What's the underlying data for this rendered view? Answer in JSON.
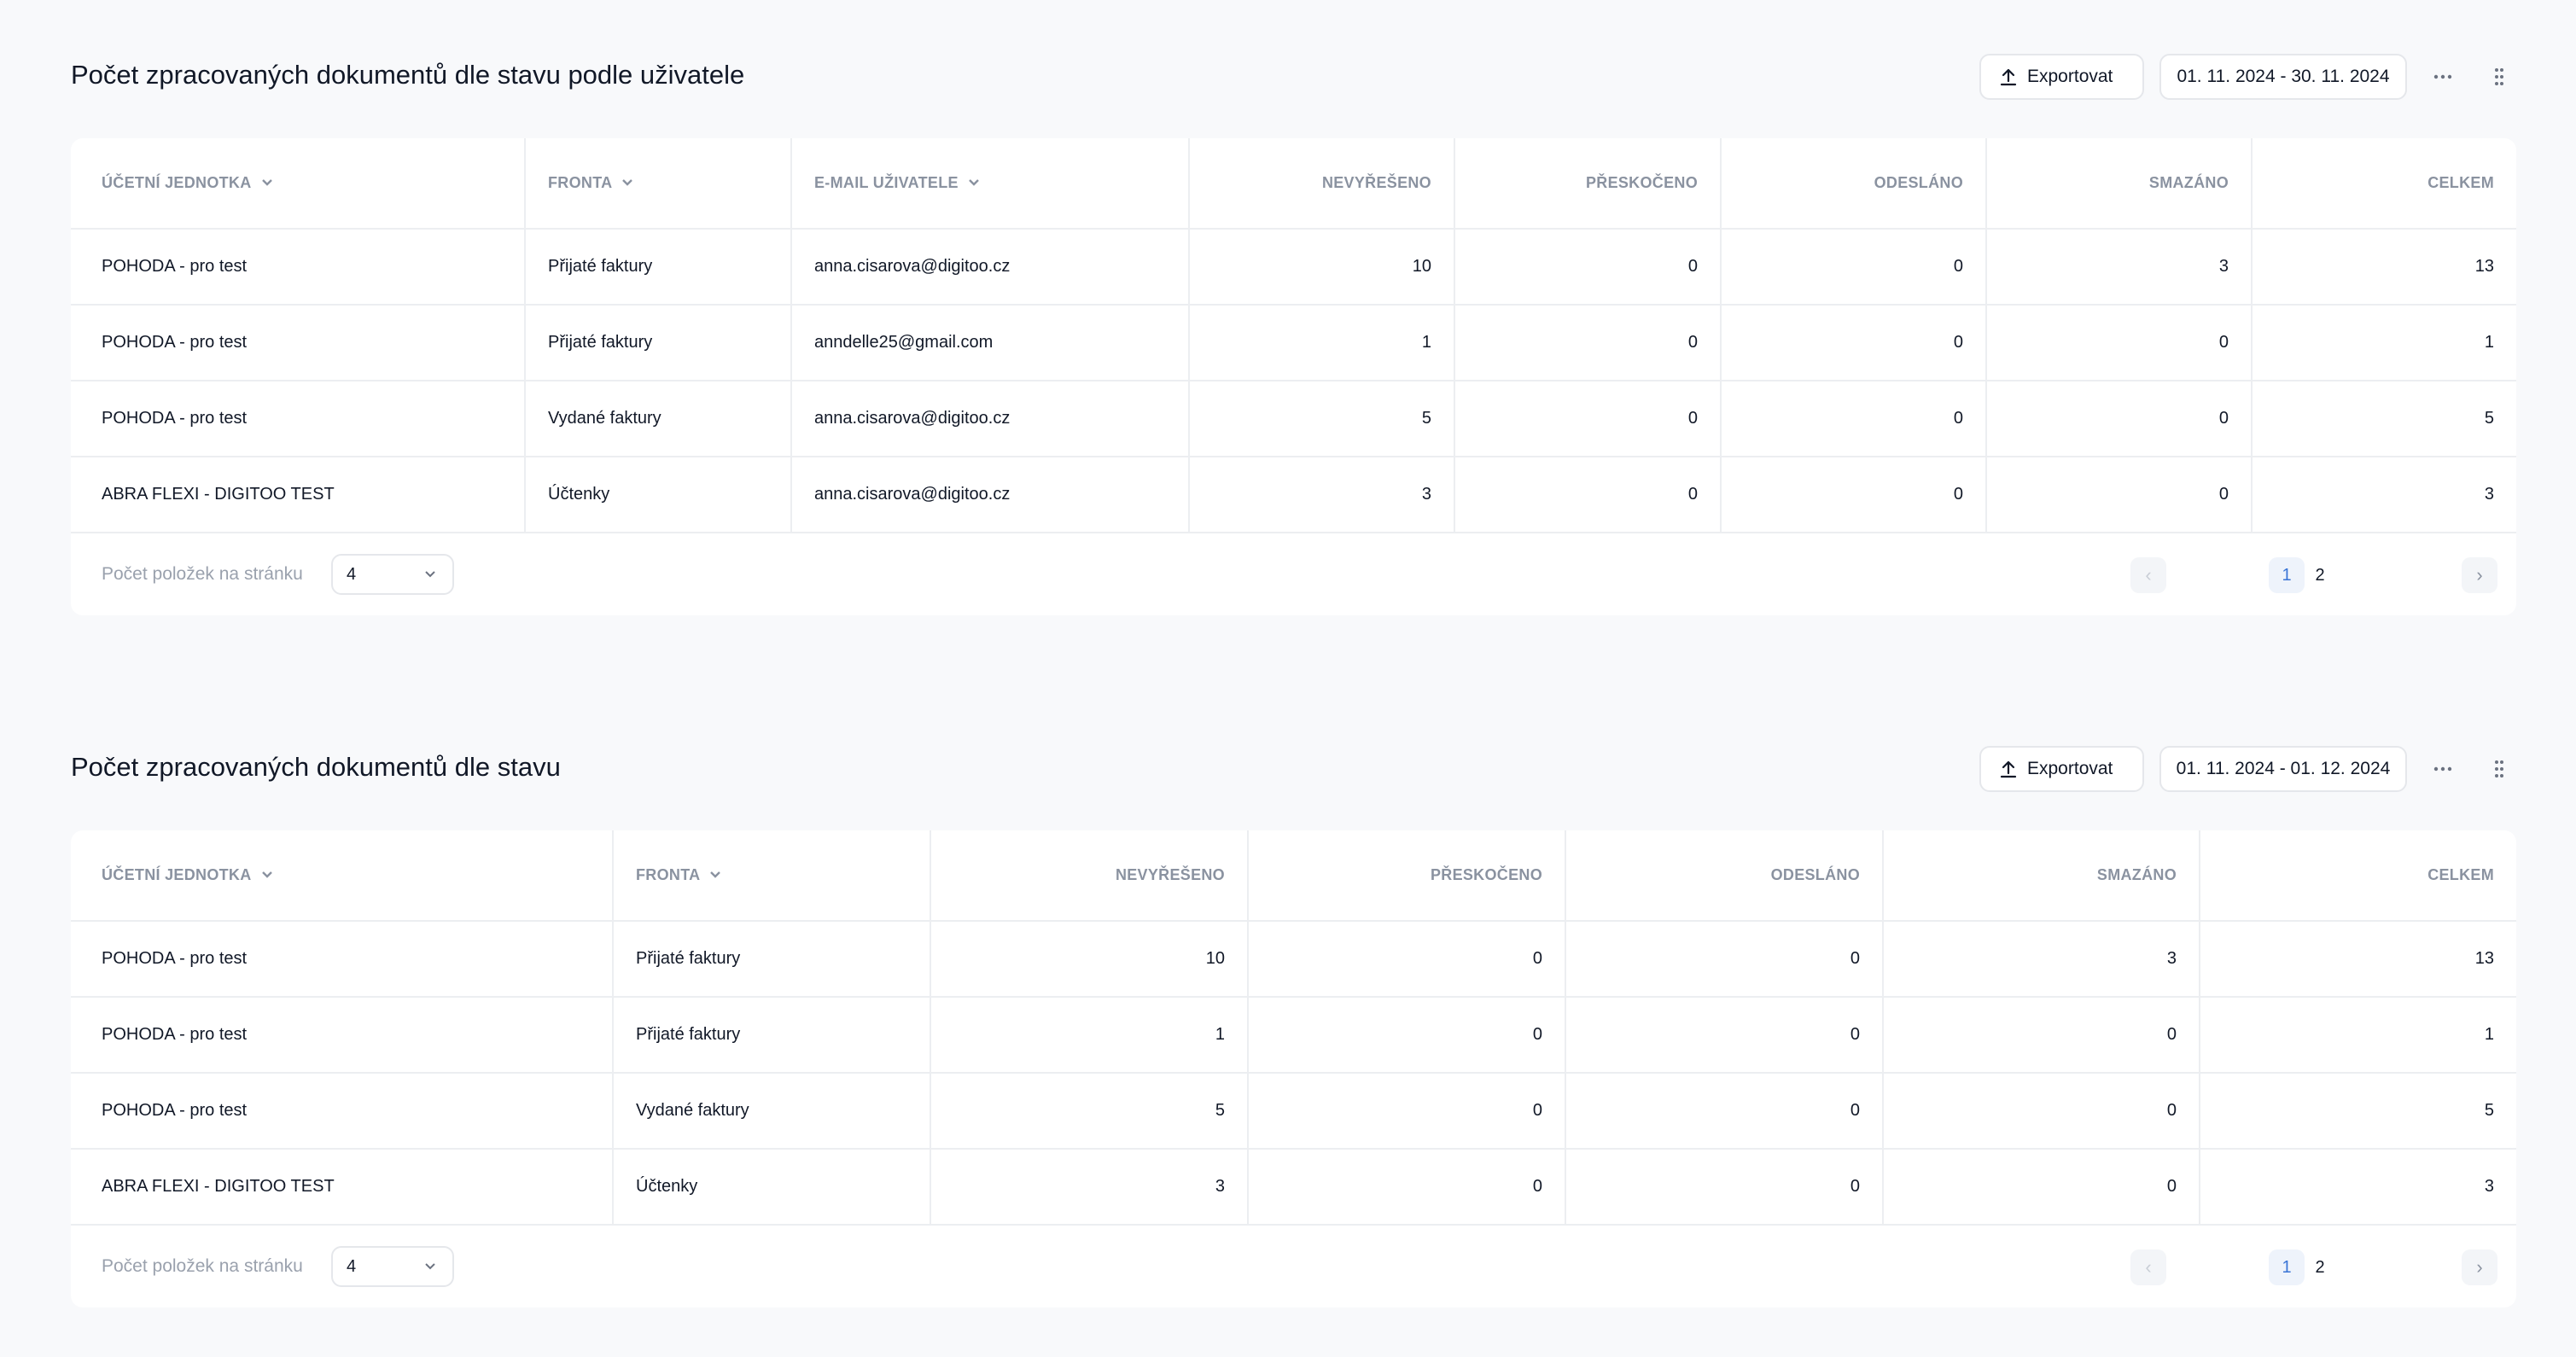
{
  "tables": [
    {
      "title": "Počet zpracovaných dokumentů dle stavu podle uživatele",
      "export_label": "Exportovat",
      "date_range": "01. 11. 2024 - 30. 11. 2024",
      "columns": [
        "Účetní jednotka",
        "Fronta",
        "E-mail uživatele",
        "Nevyřešeno",
        "Přeskočeno",
        "Odesláno",
        "Smazáno",
        "Celkem"
      ],
      "rows": [
        [
          "POHODA - pro test",
          "Přijaté faktury",
          "anna.cisarova@digitoo.cz",
          "10",
          "0",
          "0",
          "3",
          "13"
        ],
        [
          "POHODA - pro test",
          "Přijaté faktury",
          "anndelle25@gmail.com",
          "1",
          "0",
          "0",
          "0",
          "1"
        ],
        [
          "POHODA - pro test",
          "Vydané faktury",
          "anna.cisarova@digitoo.cz",
          "5",
          "0",
          "0",
          "0",
          "5"
        ],
        [
          "ABRA FLEXI - DIGITOO TEST",
          "Účtenky",
          "anna.cisarova@digitoo.cz",
          "3",
          "0",
          "0",
          "0",
          "3"
        ]
      ],
      "per_page_label": "Počet položek na stránku",
      "per_page_value": "4",
      "pages": [
        "1",
        "2"
      ],
      "prev_glyph": "‹",
      "next_glyph": "›"
    },
    {
      "title": "Počet zpracovaných dokumentů dle stavu",
      "export_label": "Exportovat",
      "date_range": "01. 11. 2024 - 01. 12. 2024",
      "columns": [
        "Účetní jednotka",
        "Fronta",
        "Nevyřešeno",
        "Přeskočeno",
        "Odesláno",
        "Smazáno",
        "Celkem"
      ],
      "rows": [
        [
          "POHODA - pro test",
          "Přijaté faktury",
          "10",
          "0",
          "0",
          "3",
          "13"
        ],
        [
          "POHODA - pro test",
          "Přijaté faktury",
          "1",
          "0",
          "0",
          "0",
          "1"
        ],
        [
          "POHODA - pro test",
          "Vydané faktury",
          "5",
          "0",
          "0",
          "0",
          "5"
        ],
        [
          "ABRA FLEXI - DIGITOO TEST",
          "Účtenky",
          "3",
          "0",
          "0",
          "0",
          "3"
        ]
      ],
      "per_page_label": "Počet položek na stránku",
      "per_page_value": "4",
      "pages": [
        "1",
        "2"
      ],
      "prev_glyph": "‹",
      "next_glyph": "›"
    }
  ],
  "icons": {
    "export": "upload-icon",
    "more": "more-horizontal-icon",
    "drag": "drag-handle-icon",
    "sort": "chevron-down-icon"
  },
  "colors": {
    "accent": "#3a74d6",
    "header_text": "#8a92a0",
    "border": "#eceef1",
    "background": "#f8f9fb"
  }
}
